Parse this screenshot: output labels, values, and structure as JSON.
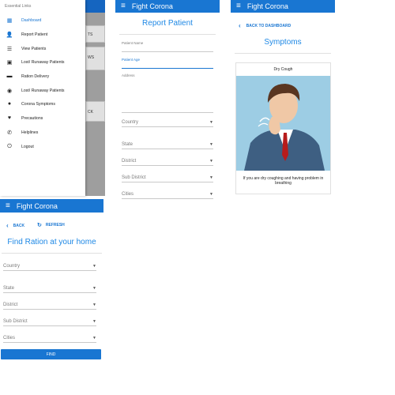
{
  "app_title": "Fight Corona",
  "drawer": {
    "header": "Essential Links",
    "items": [
      {
        "icon": "dashboard-icon",
        "label": "Dashboard",
        "active": true
      },
      {
        "icon": "person-add-icon",
        "label": "Report Patient"
      },
      {
        "icon": "list-icon",
        "label": "View Patients"
      },
      {
        "icon": "assignment-ind-icon",
        "label": "Lost/ Runaway Patients"
      },
      {
        "icon": "truck-icon",
        "label": "Ration Delivery"
      },
      {
        "icon": "globe-icon",
        "label": "Lost/ Runaway Patients"
      },
      {
        "icon": "alert-icon",
        "label": "Corona Symptoms"
      },
      {
        "icon": "heart-icon",
        "label": "Precautions"
      },
      {
        "icon": "phone-icon",
        "label": "Helplines"
      },
      {
        "icon": "power-icon",
        "label": "Logout"
      }
    ],
    "behind_labels": [
      "TS",
      "WS",
      "CK"
    ]
  },
  "report": {
    "heading": "Report Patient",
    "patient_name": "Patient Name",
    "patient_age": "Patient Age",
    "address": "Address",
    "country": "Country",
    "state": "State",
    "district": "District",
    "sub_district": "Sub District",
    "cities": "Cities"
  },
  "symptoms": {
    "back_link": "BACK TO DASHBOARD",
    "heading": "Symptoms",
    "card_title": "Dry Cough",
    "card_text": "If you are dry coughing and having problem in breathing"
  },
  "ration": {
    "back": "BACK",
    "refresh": "REFRESH",
    "heading": "Find Ration at your home",
    "country": "Country",
    "state": "State",
    "district": "District",
    "sub_district": "Sub District",
    "cities": "Cities",
    "find_button": "FIND"
  },
  "colors": {
    "primary": "#1976d2",
    "accent_heading": "#1e88e5"
  }
}
